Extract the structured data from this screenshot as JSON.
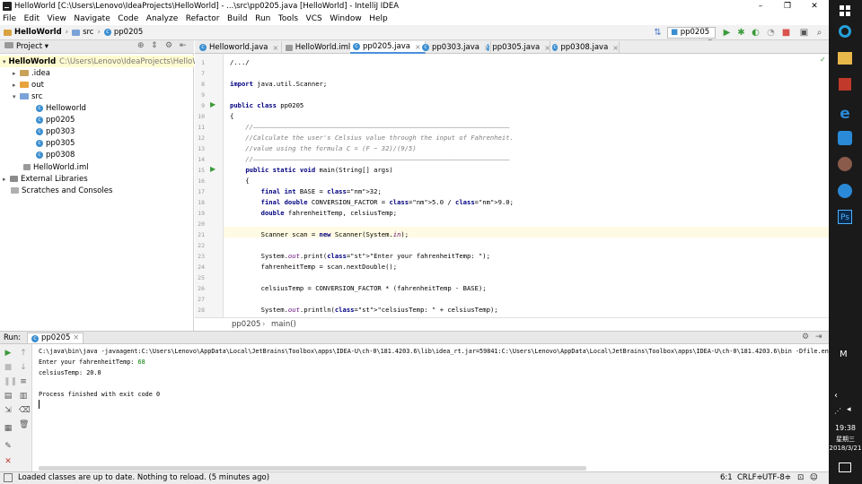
{
  "window": {
    "title": "HelloWorld [C:\\Users\\Lenovo\\IdeaProjects\\HelloWorld] - ...\\src\\pp0205.java [HelloWorld] - IntelliJ IDEA",
    "minimize": "–",
    "maximize": "❐",
    "close": "✕"
  },
  "menu": [
    "File",
    "Edit",
    "View",
    "Navigate",
    "Code",
    "Analyze",
    "Refactor",
    "Build",
    "Run",
    "Tools",
    "VCS",
    "Window",
    "Help"
  ],
  "breadcrumb": {
    "project": "HelloWorld",
    "folder": "src",
    "file": "pp0205"
  },
  "run_config": "pp0205",
  "project_panel": {
    "title": "Project",
    "tree": [
      {
        "label": "HelloWorld",
        "path": "C:\\Users\\Lenovo\\IdeaProjects\\HelloWo",
        "bold": true,
        "indent": 0,
        "icon": "folder",
        "arrow": "▾"
      },
      {
        "label": ".idea",
        "indent": 1,
        "icon": "folder",
        "arrow": "▸"
      },
      {
        "label": "out",
        "indent": 1,
        "icon": "folder-orange",
        "arrow": "▸"
      },
      {
        "label": "src",
        "indent": 1,
        "icon": "folder-blue",
        "arrow": "▾"
      },
      {
        "label": "Helloworld",
        "indent": 2,
        "icon": "class"
      },
      {
        "label": "pp0205",
        "indent": 2,
        "icon": "class"
      },
      {
        "label": "pp0303",
        "indent": 2,
        "icon": "class"
      },
      {
        "label": "pp0305",
        "indent": 2,
        "icon": "class"
      },
      {
        "label": "pp0308",
        "indent": 2,
        "icon": "class"
      },
      {
        "label": "HelloWorld.iml",
        "indent": 1,
        "icon": "iml"
      },
      {
        "label": "External Libraries",
        "indent": 0,
        "icon": "lib",
        "arrow": "▸"
      },
      {
        "label": "Scratches and Consoles",
        "indent": 0,
        "icon": "scratch"
      }
    ]
  },
  "tabs": [
    {
      "label": "Helloworld.java",
      "active": false
    },
    {
      "label": "HelloWorld.iml",
      "active": false
    },
    {
      "label": "pp0205.java",
      "active": true
    },
    {
      "label": "pp0303.java",
      "active": false
    },
    {
      "label": "pp0305.java",
      "active": false
    },
    {
      "label": "pp0308.java",
      "active": false
    }
  ],
  "code": [
    {
      "n": "1",
      "t": "/.../"
    },
    {
      "n": "7",
      "t": ""
    },
    {
      "n": "8",
      "t": "import java.util.Scanner;"
    },
    {
      "n": "9",
      "t": ""
    },
    {
      "n": "9",
      "t": "public class pp0205"
    },
    {
      "n": "10",
      "t": "{"
    },
    {
      "n": "11",
      "t": "    //——————————————————————————————————————————————————————————————————"
    },
    {
      "n": "12",
      "t": "    //Calculate the user's Celsius value through the input of Fahrenheit."
    },
    {
      "n": "13",
      "t": "    //value using the formula C = (F − 32)/(9/5)"
    },
    {
      "n": "14",
      "t": "    //——————————————————————————————————————————————————————————————————"
    },
    {
      "n": "15",
      "t": "    public static void main(String[] args)"
    },
    {
      "n": "16",
      "t": "    {"
    },
    {
      "n": "17",
      "t": "        final int BASE = 32;"
    },
    {
      "n": "18",
      "t": "        final double CONVERSION_FACTOR = 5.0 / 9.0;"
    },
    {
      "n": "19",
      "t": "        double fahrenheitTemp, celsiusTemp;"
    },
    {
      "n": "20",
      "t": ""
    },
    {
      "n": "21",
      "t": "        Scanner scan = new Scanner(System.in);"
    },
    {
      "n": "22",
      "t": ""
    },
    {
      "n": "23",
      "t": "        System.out.print(\"Enter your fahrenheitTemp: \");"
    },
    {
      "n": "24",
      "t": "        fahrenheitTemp = scan.nextDouble();"
    },
    {
      "n": "25",
      "t": ""
    },
    {
      "n": "26",
      "t": "        celsiusTemp = CONVERSION_FACTOR * (fahrenheitTemp - BASE);"
    },
    {
      "n": "27",
      "t": ""
    },
    {
      "n": "28",
      "t": "        System.out.println(\"celsiusTemp: \" + celsiusTemp);"
    }
  ],
  "nav_breadcrumb": [
    "pp0205",
    "main()"
  ],
  "run_panel": {
    "label": "Run:",
    "tab": "pp0205",
    "output": [
      "C:\\java\\bin\\java -javaagent:C:\\Users\\Lenovo\\AppData\\Local\\JetBrains\\Toolbox\\apps\\IDEA-U\\ch-0\\181.4203.6\\lib\\idea_rt.jar=59841:C:\\Users\\Lenovo\\AppData\\Local\\JetBrains\\Toolbox\\apps\\IDEA-U\\ch-0\\181.4203.6\\bin -Dfile.encodi",
      "Enter your fahrenheitTemp: ",
      "celsiusTemp: 20.0",
      "",
      "Process finished with exit code 0"
    ],
    "input_value": "68"
  },
  "status": {
    "message": "Loaded classes are up to date. Nothing to reload. (5 minutes ago)",
    "position": "6:1",
    "line_sep": "CRLF≑",
    "encoding": "UTF-8≑"
  },
  "taskbar": {
    "time": "19:38",
    "day": "星期三",
    "date": "2018/3/21",
    "ime": "M"
  }
}
